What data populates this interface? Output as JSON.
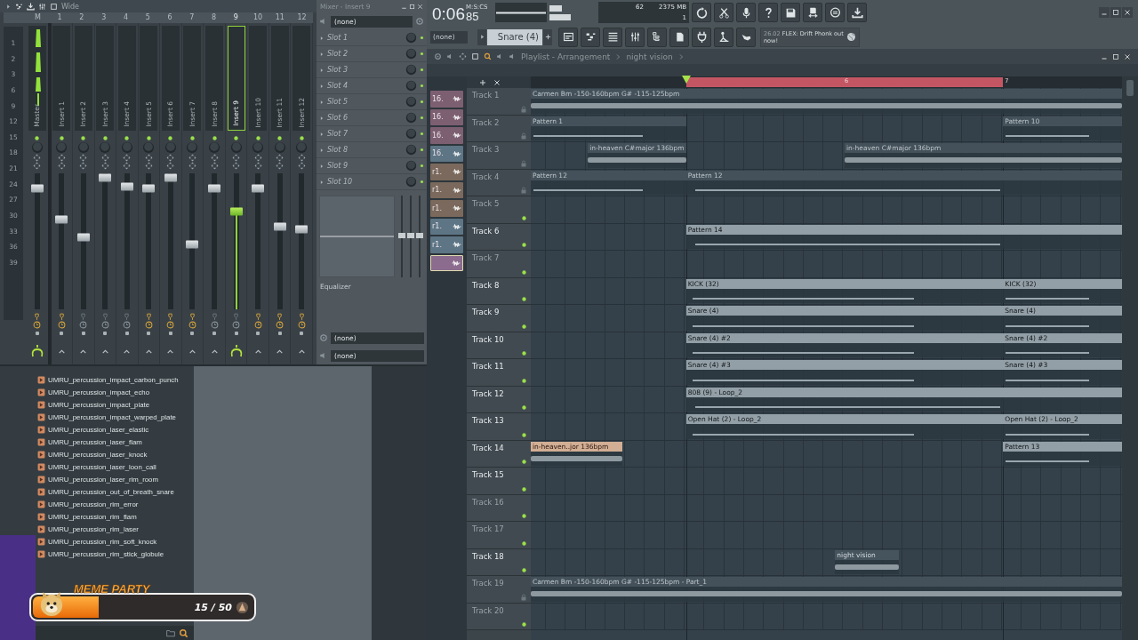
{
  "mixer": {
    "title": "Wide",
    "scale": [
      "1",
      "2",
      "3",
      "6",
      "9",
      "12",
      "15",
      "18",
      "21",
      "24",
      "27",
      "30",
      "33",
      "36",
      "39"
    ],
    "channels": [
      {
        "number": "M",
        "name": "Master",
        "level": 0.89,
        "selected": false,
        "effects_on": true,
        "routed": true
      },
      {
        "number": "1",
        "name": "Insert 1",
        "level": 0.66,
        "selected": false,
        "effects_on": true,
        "routed": false
      },
      {
        "number": "2",
        "name": "Insert 2",
        "level": 0.53,
        "selected": false,
        "effects_on": false,
        "routed": false
      },
      {
        "number": "3",
        "name": "Insert 3",
        "level": 0.97,
        "selected": false,
        "effects_on": false,
        "routed": false
      },
      {
        "number": "4",
        "name": "Insert 4",
        "level": 0.9,
        "selected": false,
        "effects_on": false,
        "routed": false
      },
      {
        "number": "5",
        "name": "Insert 5",
        "level": 0.89,
        "selected": false,
        "effects_on": true,
        "routed": false
      },
      {
        "number": "6",
        "name": "Insert 6",
        "level": 0.97,
        "selected": false,
        "effects_on": true,
        "routed": false
      },
      {
        "number": "7",
        "name": "Insert 7",
        "level": 0.48,
        "selected": false,
        "effects_on": true,
        "routed": false
      },
      {
        "number": "8",
        "name": "Insert 8",
        "level": 0.89,
        "selected": false,
        "effects_on": false,
        "routed": false
      },
      {
        "number": "9",
        "name": "Insert 9",
        "level": 0.72,
        "selected": true,
        "effects_on": false,
        "routed": true
      },
      {
        "number": "10",
        "name": "Insert 10",
        "level": 0.89,
        "selected": false,
        "effects_on": true,
        "routed": false
      },
      {
        "number": "11",
        "name": "Insert 11",
        "level": 0.61,
        "selected": false,
        "effects_on": true,
        "routed": false
      },
      {
        "number": "12",
        "name": "Insert 12",
        "level": 0.59,
        "selected": false,
        "effects_on": true,
        "routed": false
      }
    ]
  },
  "insert_panel": {
    "title": "Mixer - Insert 9",
    "input": "(none)",
    "slots": [
      "Slot 1",
      "Slot 2",
      "Slot 3",
      "Slot 4",
      "Slot 5",
      "Slot 6",
      "Slot 7",
      "Slot 8",
      "Slot 9",
      "Slot 10"
    ],
    "eq_label": "Equalizer",
    "outputs": [
      "(none)",
      "(none)"
    ]
  },
  "browser": {
    "items": [
      "UMRU_percussion_impact_carbon_punch",
      "UMRU_percussion_impact_echo",
      "UMRU_percussion_impact_plate",
      "UMRU_percussion_impact_warped_plate",
      "UMRU_percussion_laser_elastic",
      "UMRU_percussion_laser_flam",
      "UMRU_percussion_laser_knock",
      "UMRU_percussion_laser_loon_call",
      "UMRU_percussion_laser_rim_room",
      "UMRU_percussion_out_of_breath_snare",
      "UMRU_percussion_rim_error",
      "UMRU_percussion_rim_flam",
      "UMRU_percussion_rim_laser",
      "UMRU_percussion_rim_soft_knock",
      "UMRU_percussion_rim_stick_globule"
    ]
  },
  "stream_widget": {
    "title": "MEME PARTY",
    "count": "15 / 50",
    "level": 0.3
  },
  "toolbar": {
    "time": "0:06",
    "time_cs": "85",
    "time_unit": "M:S:CS",
    "cpu": "62",
    "memory": "2375 MB",
    "polyphony": "1",
    "channel_select": "(none)",
    "pattern": "Snare (4)",
    "news_date": "26.02",
    "news": "FLEX: Drift Phonk out now!"
  },
  "playlist": {
    "breadcrumb": [
      "Playlist - Arrangement",
      "night vision"
    ],
    "markers": [
      {
        "label": "6"
      },
      {
        "label": "7"
      }
    ],
    "picker": [
      {
        "label": "16.",
        "color": "#7d5f72",
        "selected": false
      },
      {
        "label": "16.",
        "color": "#7d5f72",
        "selected": false
      },
      {
        "label": "16.",
        "color": "#7d5f72",
        "selected": false
      },
      {
        "label": "16.",
        "color": "#5d7585",
        "selected": false
      },
      {
        "label": "r1.",
        "color": "#7a695c",
        "selected": false
      },
      {
        "label": "r1.",
        "color": "#7a695c",
        "selected": false
      },
      {
        "label": "r1.",
        "color": "#7a695c",
        "selected": false
      },
      {
        "label": "r1.",
        "color": "#5d7585",
        "selected": false
      },
      {
        "label": "r1.",
        "color": "#5d7585",
        "selected": false
      },
      {
        "color": "#8b6c8e",
        "selected": true
      }
    ],
    "tracks": [
      {
        "name": "Track 1",
        "active": false,
        "locked": true,
        "clips": [
          {
            "label": "Carmen Bm -150-160bpm G# -115-125bpm",
            "kind": "audio",
            "selected": false
          }
        ]
      },
      {
        "name": "Track 2",
        "active": false,
        "locked": true,
        "clips": [
          {
            "label": "Pattern 1",
            "kind": "pattern",
            "selected": false
          },
          {
            "label": "Pattern 10",
            "kind": "pattern",
            "selected": false
          }
        ]
      },
      {
        "name": "Track 3",
        "active": false,
        "locked": true,
        "clips": [
          {
            "label": "in-heaven C#major 136bpm",
            "kind": "audio",
            "selected": false
          },
          {
            "label": "in-heaven C#major 136bpm",
            "kind": "audio",
            "selected": false
          }
        ]
      },
      {
        "name": "Track 4",
        "active": false,
        "locked": true,
        "clips": [
          {
            "label": "Pattern 12",
            "kind": "pattern",
            "selected": false
          },
          {
            "label": "Pattern 12",
            "kind": "pattern",
            "selected": false
          }
        ]
      },
      {
        "name": "Track 5",
        "active": false,
        "locked": false
      },
      {
        "name": "Track 6",
        "active": true,
        "locked": false,
        "clips": [
          {
            "label": "Pattern 14",
            "kind": "pattern",
            "selected": false
          }
        ]
      },
      {
        "name": "Track 7",
        "active": false,
        "locked": false
      },
      {
        "name": "Track 8",
        "active": true,
        "locked": false,
        "clips": [
          {
            "label": "KICK (32)",
            "kind": "pattern",
            "selected": false
          },
          {
            "label": "KICK (32)",
            "kind": "pattern",
            "selected": false
          }
        ]
      },
      {
        "name": "Track 9",
        "active": true,
        "locked": false,
        "clips": [
          {
            "label": "Snare (4)",
            "kind": "pattern",
            "selected": false
          },
          {
            "label": "Snare (4)",
            "kind": "pattern",
            "selected": false
          }
        ]
      },
      {
        "name": "Track 10",
        "active": true,
        "locked": false,
        "clips": [
          {
            "label": "Snare (4) #2",
            "kind": "pattern",
            "selected": false
          },
          {
            "label": "Snare (4) #2",
            "kind": "pattern",
            "selected": false
          }
        ]
      },
      {
        "name": "Track 11",
        "active": true,
        "locked": false,
        "clips": [
          {
            "label": "Snare (4) #3",
            "kind": "pattern",
            "selected": false
          },
          {
            "label": "Snare (4) #3",
            "kind": "pattern",
            "selected": false
          }
        ]
      },
      {
        "name": "Track 12",
        "active": true,
        "locked": false,
        "clips": [
          {
            "label": "808 (9) - Loop_2",
            "kind": "pattern",
            "selected": false
          }
        ]
      },
      {
        "name": "Track 13",
        "active": true,
        "locked": false,
        "clips": [
          {
            "label": "Open Hat (2) - Loop_2",
            "kind": "pattern",
            "selected": false
          },
          {
            "label": "Open Hat (2) - Loop_2",
            "kind": "pattern",
            "selected": false
          }
        ]
      },
      {
        "name": "Track 14",
        "active": true,
        "locked": false,
        "clips": [
          {
            "label": "in-heaven..jor 136bpm",
            "kind": "audio",
            "selected": true
          },
          {
            "label": "Pattern 13",
            "kind": "pattern",
            "selected": false
          }
        ]
      },
      {
        "name": "Track 15",
        "active": true,
        "locked": false
      },
      {
        "name": "Track 16",
        "active": false,
        "locked": false
      },
      {
        "name": "Track 17",
        "active": false,
        "locked": false
      },
      {
        "name": "Track 18",
        "active": true,
        "locked": false,
        "clips": [
          {
            "label": "night vision",
            "kind": "audio",
            "selected": false
          }
        ]
      },
      {
        "name": "Track 19",
        "active": false,
        "locked": true,
        "clips": [
          {
            "label": "Carmen Bm -150-160bpm G# -115-125bpm - Part_1",
            "kind": "audio",
            "selected": false
          }
        ]
      },
      {
        "name": "Track 20",
        "active": false,
        "locked": false
      }
    ]
  }
}
